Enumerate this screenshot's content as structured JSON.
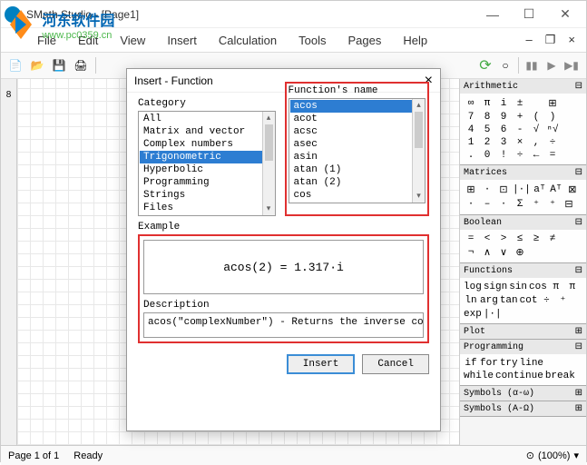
{
  "window": {
    "title": "SMath Studio - [Page1]"
  },
  "watermark": {
    "title": "河东软件园",
    "url": "www.pc0359.cn"
  },
  "menu": {
    "items": [
      "File",
      "Edit",
      "View",
      "Insert",
      "Calculation",
      "Tools",
      "Pages",
      "Help"
    ]
  },
  "ruler": {
    "vlabel": "8"
  },
  "dialog": {
    "title": "Insert - Function",
    "category_label": "Category",
    "categories": [
      "All",
      "Matrix and vector",
      "Complex numbers",
      "Trigonometric",
      "Hyperbolic",
      "Programming",
      "Strings",
      "Files"
    ],
    "category_selected": "Trigonometric",
    "func_label": "Function's name",
    "functions": [
      "acos",
      "acot",
      "acsc",
      "asec",
      "asin",
      "atan (1)",
      "atan (2)",
      "cos"
    ],
    "function_selected": "acos",
    "example_label": "Example",
    "example_text": "acos(2) = 1.317·i",
    "description_label": "Description",
    "description_text": "acos(\"complexNumber\") - Returns the inverse cosine",
    "insert_btn": "Insert",
    "cancel_btn": "Cancel"
  },
  "panels": {
    "arithmetic": {
      "title": "Arithmetic",
      "rows": [
        [
          "∞",
          "π",
          "i",
          "±",
          "",
          "⊞"
        ],
        [
          "7",
          "8",
          "9",
          "+",
          "(",
          ")"
        ],
        [
          "4",
          "5",
          "6",
          "-",
          "√",
          "ⁿ√"
        ],
        [
          "1",
          "2",
          "3",
          "×",
          ",",
          "÷"
        ],
        [
          ".",
          "0",
          "!",
          "÷",
          "←",
          "="
        ]
      ]
    },
    "matrices": {
      "title": "Matrices",
      "rows": [
        [
          "⊞",
          "·",
          "⊡",
          "|·|",
          "aᵀ",
          "Aᵀ",
          "⊠"
        ],
        [
          "·",
          "–",
          "·",
          "Σ",
          "⁺",
          "⁺",
          "⊟"
        ]
      ]
    },
    "boolean": {
      "title": "Boolean",
      "rows": [
        [
          "=",
          "<",
          ">",
          "≤",
          "≥",
          "≠"
        ],
        [
          "¬",
          "∧",
          "∨",
          "⊕",
          "",
          ""
        ]
      ]
    },
    "functions": {
      "title": "Functions",
      "rows": [
        [
          "log",
          "sign",
          "sin",
          "cos",
          "π",
          "π"
        ],
        [
          "ln",
          "arg",
          "tan",
          "cot",
          "÷",
          "⁺"
        ],
        [
          "exp",
          "|·|",
          "",
          "",
          "",
          ""
        ]
      ]
    },
    "plot": {
      "title": "Plot"
    },
    "programming": {
      "title": "Programming",
      "rows": [
        [
          "if",
          "for",
          "try",
          "line"
        ],
        [
          "while",
          "continue",
          "break"
        ]
      ]
    },
    "symbols1": {
      "title": "Symbols (α-ω)"
    },
    "symbols2": {
      "title": "Symbols (Α-Ω)"
    }
  },
  "statusbar": {
    "page": "Page 1 of 1",
    "ready": "Ready",
    "zoom": "(100%)"
  }
}
